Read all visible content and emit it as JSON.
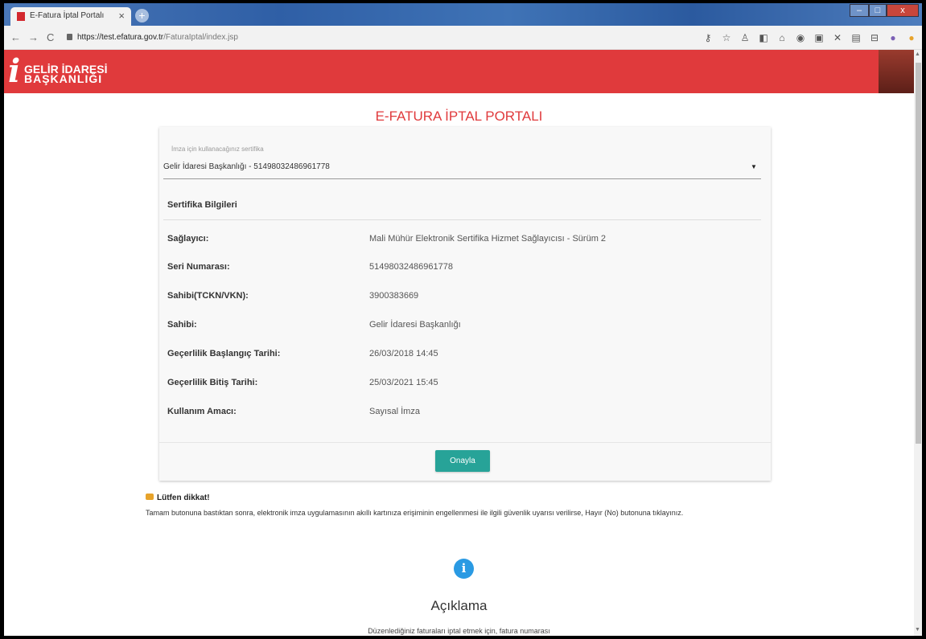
{
  "browser": {
    "tab_title": "E-Fatura İptal Portalı",
    "tab_close": "×",
    "new_tab": "+",
    "url_host": "https://test.efatura.gov.tr",
    "url_path": "/FaturaIptal/index.jsp",
    "nav": {
      "back": "←",
      "forward": "→",
      "reload": "C"
    },
    "window_controls": {
      "minimize": "–",
      "maximize": "□",
      "close": "x"
    },
    "extension_icons": [
      "key-icon",
      "star-icon",
      "person-icon",
      "extension-icon",
      "lock-icon",
      "extension-icon",
      "extension-icon",
      "extension-icon",
      "extension-icon",
      "extension-icon",
      "profile-icon",
      "extension-icon"
    ]
  },
  "brand": {
    "line1": "GELİR İDARESİ",
    "line2": "BAŞKANLIĞI",
    "mark": "i",
    "color": "#e03a3c"
  },
  "page": {
    "title": "E-FATURA İPTAL PORTALI"
  },
  "certificate_select": {
    "label": "İmza için kullanacağınız sertifika",
    "value": "Gelir İdaresi Başkanlığı - 51498032486961778",
    "arrow": "▼"
  },
  "cert_info": {
    "title": "Sertifika Bilgileri",
    "rows": [
      {
        "key": "Sağlayıcı:",
        "value": "Mali Mühür Elektronik Sertifika Hizmet Sağlayıcısı - Sürüm 2"
      },
      {
        "key": "Seri Numarası:",
        "value": "51498032486961778"
      },
      {
        "key": "Sahibi(TCKN/VKN):",
        "value": "3900383669"
      },
      {
        "key": "Sahibi:",
        "value": "Gelir İdaresi Başkanlığı"
      },
      {
        "key": "Geçerlilik Başlangıç Tarihi:",
        "value": "26/03/2018 14:45"
      },
      {
        "key": "Geçerlilik Bitiş Tarihi:",
        "value": "25/03/2021 15:45"
      },
      {
        "key": "Kullanım Amacı:",
        "value": "Sayısal İmza"
      }
    ]
  },
  "confirm_button": {
    "label": "Onayla",
    "color": "#27a398"
  },
  "notice": {
    "title": "Lütfen dikkat!",
    "text": "Tamam butonuna bastıktan sonra, elektronik imza uygulamasının akıllı kartınıza erişiminin engellenmesi ile ilgili güvenlik uyarısı verilirse, Hayır (No) butonuna tıklayınız."
  },
  "description": {
    "icon": "i",
    "title": "Açıklama",
    "text": "Düzenlediğiniz faturaları iptal etmek için, fatura numarası"
  }
}
